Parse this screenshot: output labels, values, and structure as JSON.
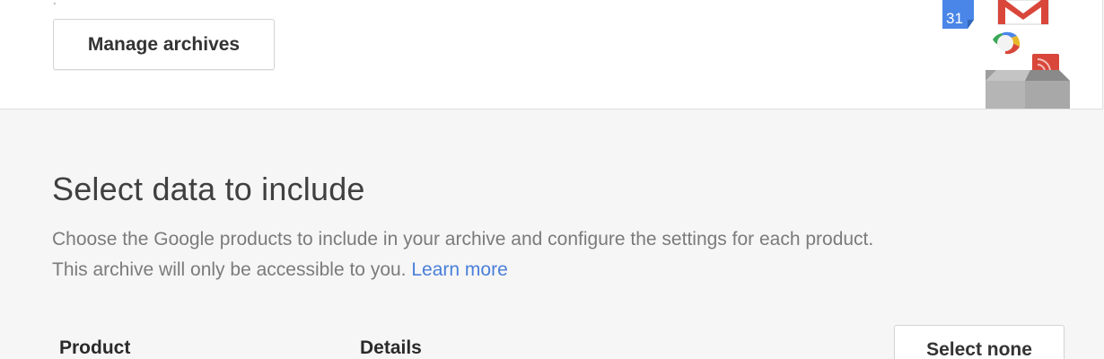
{
  "top_card": {
    "manage_archives_label": "Manage archives"
  },
  "section": {
    "title": "Select data to include",
    "description_line1": "Choose the Google products to include in your archive and configure the settings for each product.",
    "description_line2": "This archive will only be accessible to you.",
    "learn_more_label": "Learn more"
  },
  "table": {
    "headers": {
      "product": "Product",
      "details": "Details"
    },
    "select_none_label": "Select none"
  },
  "illustration": {
    "calendar_number": "31",
    "icons": [
      "calendar-icon",
      "gmail-icon",
      "google-plus-hangouts-icon",
      "rss-icon",
      "archive-box-icon"
    ]
  },
  "colors": {
    "link": "#4a7fd9",
    "background": "#f6f6f6",
    "card": "#ffffff",
    "calendar_blue": "#4a86e8",
    "gmail_red": "#d9473a"
  }
}
